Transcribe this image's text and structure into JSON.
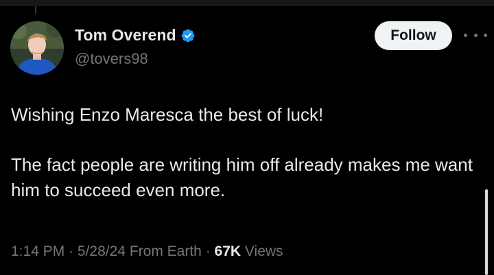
{
  "tweet": {
    "author": {
      "display_name": "Tom Overend",
      "handle": "@tovers98",
      "verified": true,
      "verified_color": "#1d9bf0"
    },
    "follow_label": "Follow",
    "more_icon": "more-horizontal-icon",
    "text_paragraphs": [
      "Wishing Enzo Maresca the best of luck!",
      "The fact people are writing him off already makes me want him to succeed even more."
    ],
    "time": "1:14 PM",
    "date": "5/28/24",
    "location": "From Earth",
    "separator": "·",
    "views_count": "67K",
    "views_label": "Views"
  },
  "colors": {
    "background": "#000000",
    "primary_text": "#e7e9ea",
    "secondary_text": "#71767b",
    "follow_button_bg": "#eff3f4"
  }
}
